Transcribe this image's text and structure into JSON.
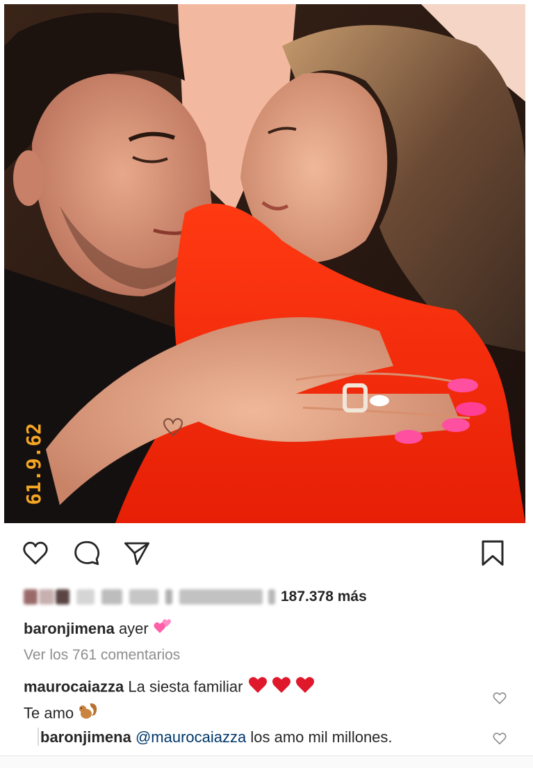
{
  "post": {
    "photo_date_stamp": "61.9.62",
    "accent_colors": {
      "stamp": "#f5a623",
      "link": "#00376b",
      "muted": "#8e8e8e"
    }
  },
  "actions": {
    "like_icon": "heart-outline-icon",
    "comment_icon": "comment-bubble-icon",
    "share_icon": "paper-plane-icon",
    "save_icon": "bookmark-icon"
  },
  "likes": {
    "count_text": "187.378 más"
  },
  "caption": {
    "username": "baronjimena",
    "text": "ayer",
    "emoji": "two-hearts-emoji"
  },
  "view_comments": "Ver los 761 comentarios",
  "comments": [
    {
      "username": "maurocaiazza",
      "text_line1": "La siesta familiar",
      "emoji_line1": "red-heart-emoji x3",
      "text_line2": "Te amo",
      "emoji_line2": "squirrel-emoji"
    }
  ],
  "reply": {
    "username": "baronjimena",
    "mention": "@maurocaiazza",
    "text": "los amo mil millones."
  }
}
